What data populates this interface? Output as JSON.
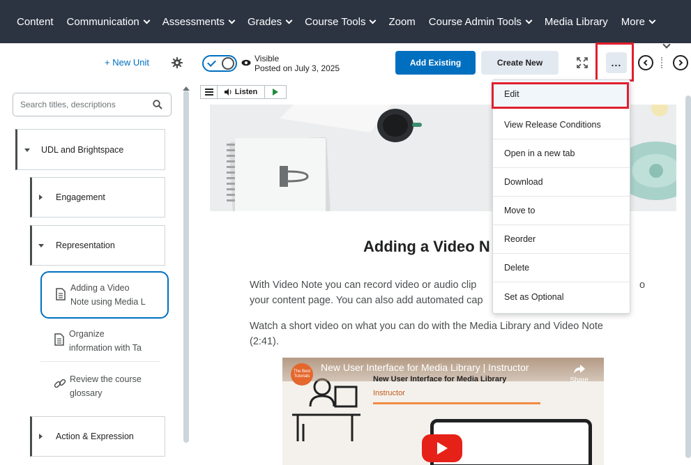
{
  "topnav": {
    "items": [
      {
        "label": "Content",
        "dropdown": false
      },
      {
        "label": "Communication",
        "dropdown": true
      },
      {
        "label": "Assessments",
        "dropdown": true
      },
      {
        "label": "Grades",
        "dropdown": true
      },
      {
        "label": "Course Tools",
        "dropdown": true
      },
      {
        "label": "Zoom",
        "dropdown": false
      },
      {
        "label": "Course Admin Tools",
        "dropdown": true
      },
      {
        "label": "Media Library",
        "dropdown": false
      },
      {
        "label": "More",
        "dropdown": true
      }
    ]
  },
  "sidebar": {
    "new_unit_label": "+ New Unit",
    "search_placeholder": "Search titles, descriptions",
    "units": [
      {
        "label": "UDL and Brightspace",
        "expanded": true
      },
      {
        "label": "Engagement",
        "expanded": false
      },
      {
        "label": "Representation",
        "expanded": true
      },
      {
        "label": "Action & Expression",
        "expanded": false
      }
    ],
    "topics": [
      {
        "line1": "Adding a Video",
        "line2": "Note using Media L",
        "icon": "document-icon",
        "selected": true
      },
      {
        "line1": "Organize",
        "line2": "information with Ta",
        "icon": "document-icon",
        "selected": false
      },
      {
        "line1": "Review the course",
        "line2": "glossary",
        "icon": "link-icon",
        "selected": false
      }
    ]
  },
  "header": {
    "visibility_label": "Visible",
    "posted_label": "Posted on July 3, 2025",
    "add_existing": "Add Existing",
    "create_new": "Create New",
    "more_label": "..."
  },
  "menu": {
    "items": [
      "Edit",
      "View Release Conditions",
      "Open in a new tab",
      "Download",
      "Move to",
      "Reorder",
      "Delete",
      "Set as Optional"
    ]
  },
  "content": {
    "listen_label": "Listen",
    "heading": "Adding a Video N",
    "para1_line1": "With Video Note you can record video or audio clip",
    "para1_line1_tail": "o",
    "para1_line2": "your content page.  You can also add automated cap",
    "para2_line1": "Watch a short video on what you can do with the Media Library and Video Note",
    "para2_line2": "(2:41).",
    "video": {
      "title": "New User Interface for Media Library | Instructor",
      "slide_title": "New User Interface for Media Library",
      "slide_sub": "Instructor",
      "share_label": "Share",
      "logo_text": "The Best Tutorials"
    }
  },
  "colors": {
    "nav_bg": "#2c3442",
    "primary": "#006fbf",
    "highlight_red": "#e01e2d",
    "secondary_btn": "#e3e9f1"
  }
}
